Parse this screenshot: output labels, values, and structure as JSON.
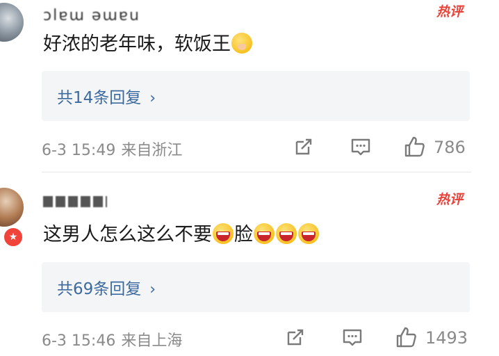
{
  "comments": [
    {
      "username": "ɔlɐɯ ǝɯɐu",
      "hot_label": "热评",
      "text": "好浓的老年味，软饭王",
      "emojis": [
        "shush-face"
      ],
      "replies_label": "共14条回复",
      "date": "6-3 15:49",
      "location": "来自浙江",
      "likes": "786"
    },
    {
      "username": "",
      "hot_label": "热评",
      "text": "这男人怎么这么不要",
      "text_after": "脸",
      "emojis": [
        "laughing-face",
        "laughing-face",
        "laughing-face",
        "laughing-face"
      ],
      "replies_label": "共69条回复",
      "date": "6-3 15:46",
      "location": "来自上海",
      "likes": "1493"
    }
  ],
  "icons": {
    "share": "share-icon",
    "reply": "comment-icon",
    "like": "thumbs-up-icon",
    "chevron": "chevron-right-icon"
  },
  "colors": {
    "hot": "#e8433a",
    "link": "#3d6a9e",
    "meta": "#8a8a8a",
    "reply_bg": "#f4f5f7"
  }
}
